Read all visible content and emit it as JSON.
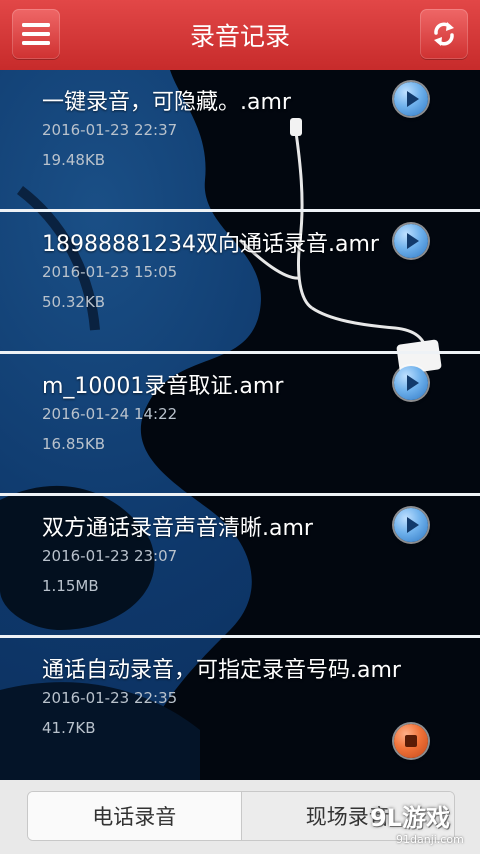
{
  "header": {
    "title": "录音记录",
    "menu_icon": "menu-icon",
    "refresh_icon": "refresh-icon",
    "color": "#d83a3a"
  },
  "recordings": [
    {
      "name": "一键录音，可隐藏。.amr",
      "date": "2016-01-23 22:37",
      "size": "19.48KB",
      "action": "play"
    },
    {
      "name": "18988881234双向通话录音.amr",
      "date": "2016-01-23 15:05",
      "size": "50.32KB",
      "action": "play"
    },
    {
      "name": "m_10001录音取证.amr",
      "date": "2016-01-24 14:22",
      "size": "16.85KB",
      "action": "play"
    },
    {
      "name": "双方通话录音声音清晰.amr",
      "date": "2016-01-23 23:07",
      "size": "1.15MB",
      "action": "play"
    },
    {
      "name": "通话自动录音，可指定录音号码.amr",
      "date": "2016-01-23 22:35",
      "size": "41.7KB",
      "action": "stop"
    }
  ],
  "tabs": [
    {
      "label": "电话录音",
      "active": true
    },
    {
      "label": "现场录音",
      "active": false
    }
  ],
  "watermark": {
    "logo": "9L游戏",
    "url": "91danji.com"
  }
}
